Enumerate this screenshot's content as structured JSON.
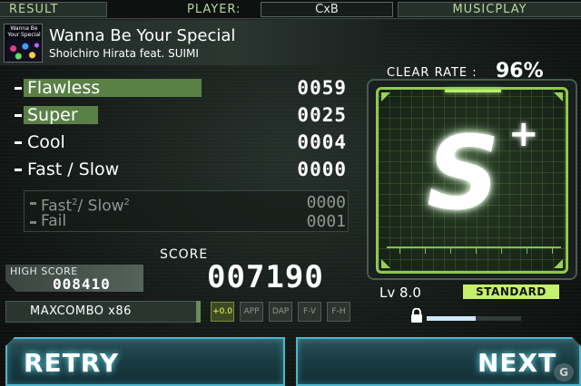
{
  "topbar": {
    "result": "RESULT",
    "player_label": "PLAYER:",
    "player_name": "CxB",
    "mode": "MUSICPLAY"
  },
  "song": {
    "jacket_text": "Wanna Be Your Special",
    "title": "Wanna Be Your Special",
    "artist": "Shoichiro Hirata feat. SUIMI"
  },
  "judgements": [
    {
      "label": "Flawless",
      "count": "0059",
      "bar_fraction": 1.0
    },
    {
      "label": "Super",
      "count": "0025",
      "bar_fraction": 0.42
    },
    {
      "label": "Cool",
      "count": "0004",
      "bar_fraction": 0.0
    },
    {
      "label": "Fast / Slow",
      "count": "0000",
      "bar_fraction": 0.0
    }
  ],
  "sub_judgements": {
    "fast_slow_a": "Fast",
    "fast_slow_b": "/ Slow",
    "sup": "2",
    "fast_slow_count": "0000",
    "fail_label": "Fail",
    "fail_count": "0001"
  },
  "score": {
    "label": "SCORE",
    "value": "007190",
    "high_label": "HIGH SCORE",
    "high_value": "008410"
  },
  "maxcombo": "MAXCOMBO x86",
  "options": [
    {
      "label": "+0.0",
      "active": true
    },
    {
      "label": "APP",
      "active": false
    },
    {
      "label": "DAP",
      "active": false
    },
    {
      "label": "F-V",
      "active": false
    },
    {
      "label": "F-H",
      "active": false
    }
  ],
  "grade": {
    "clear_rate_label": "CLEAR RATE :",
    "clear_rate": "96%",
    "letter": "S",
    "plus": "+"
  },
  "gauge_labels": [
    "",
    "",
    "",
    "",
    "",
    "",
    "",
    ""
  ],
  "level": {
    "label": "Lv 8.0",
    "difficulty": "STANDARD",
    "unlock_progress": 0.52
  },
  "buttons": {
    "retry": "RETRY",
    "next": "NEXT"
  },
  "colors": {
    "accent_green": "#8fc94e",
    "button_cyan": "#4fb5cc",
    "badge": "#c5f06a"
  }
}
